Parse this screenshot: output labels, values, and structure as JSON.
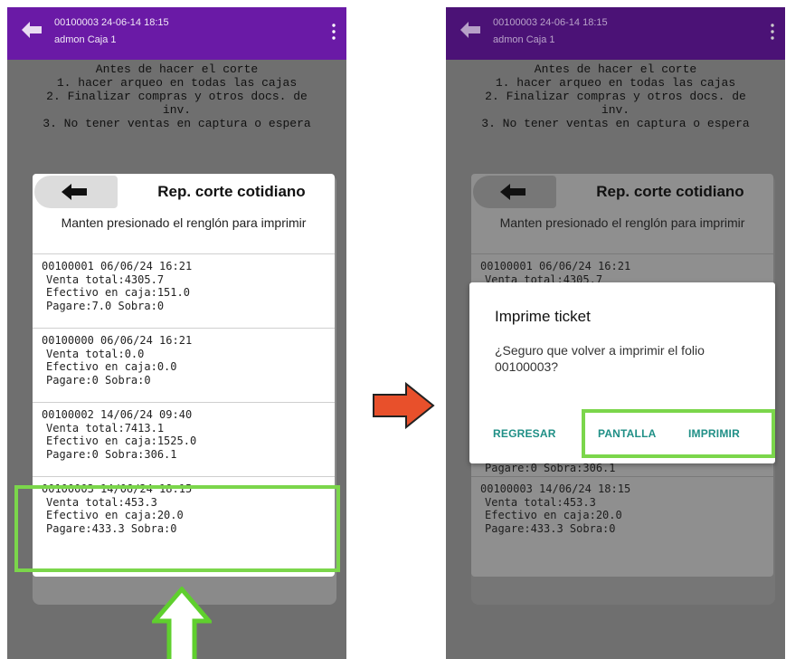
{
  "header": {
    "line1": "00100003 24-06-14 18:15",
    "line2": "admon Caja 1"
  },
  "note": {
    "l1": "Antes de hacer el corte",
    "l2": "1. hacer arqueo en todas las cajas",
    "l3": "2. Finalizar compras y otros docs. de",
    "l4": "inv.",
    "l5": "3. No tener ventas en captura o espera"
  },
  "report": {
    "title": "Rep. corte cotidiano",
    "subtitle": "Manten presionado el renglón para imprimir",
    "rows": [
      {
        "id": "00100001 06/06/24 16:21",
        "venta": "Venta total:4305.7",
        "efectivo": "Efectivo en caja:151.0",
        "pagare": "Pagare:7.0 Sobra:0"
      },
      {
        "id": "00100000 06/06/24 16:21",
        "venta": "Venta total:0.0",
        "efectivo": "Efectivo en caja:0.0",
        "pagare": "Pagare:0 Sobra:0"
      },
      {
        "id": "00100002 14/06/24 09:40",
        "venta": "Venta total:7413.1",
        "efectivo": "Efectivo en caja:1525.0",
        "pagare": "Pagare:0 Sobra:306.1"
      },
      {
        "id": "00100003 14/06/24 18:15",
        "venta": "Venta total:453.3",
        "efectivo": "Efectivo en caja:20.0",
        "pagare": "Pagare:433.3 Sobra:0"
      }
    ],
    "partial_row1_line2": "Venta total:4305.7"
  },
  "dialog": {
    "title": "Imprime ticket",
    "message": "¿Seguro que volver a imprimir el folio 00100003?",
    "btn_regresar": "REGRESAR",
    "btn_pantalla": "PANTALLA",
    "btn_imprimir": "IMPRIMIR"
  },
  "colors": {
    "topbar": "#6a1aa6",
    "highlight": "#7bd64b",
    "arrow_right": "#e8502b",
    "dialog_button": "#1f8f86"
  },
  "icons": {
    "back": "arrow-left-icon",
    "menu": "more-vertical-icon",
    "pointer_up": "arrow-up-icon",
    "pointer_right": "arrow-right-icon"
  }
}
